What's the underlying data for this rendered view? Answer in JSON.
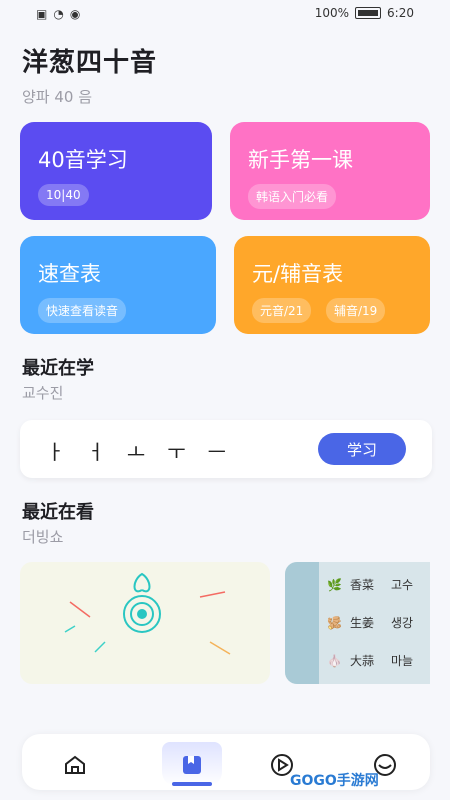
{
  "status": {
    "battery": "100%",
    "time": "6:20"
  },
  "header": {
    "title": "洋葱四十音",
    "subtitle": "양파 40 음"
  },
  "cards": {
    "c1": {
      "title": "40音学习",
      "chip": "10|40"
    },
    "c2": {
      "title": "新手第一课",
      "chip": "韩语入门必看"
    },
    "c3": {
      "title": "速查表",
      "chip": "快速查看读音"
    },
    "c4": {
      "title": "元/辅音表",
      "chip1": "元音/21",
      "chip2": "辅音/19"
    }
  },
  "recent_study": {
    "title": "最近在学",
    "subtitle": "교수진",
    "vowels": [
      "ㅏ",
      "ㅓ",
      "ㅗ",
      "ㅜ",
      "ㅡ"
    ],
    "button": "学习"
  },
  "recent_watch": {
    "title": "最近在看",
    "subtitle": "더빙쇼",
    "video2_rows": [
      {
        "zh": "香菜",
        "kr": "고수",
        "icon": "cilantro-icon"
      },
      {
        "zh": "生姜",
        "kr": "생강",
        "icon": "ginger-icon"
      },
      {
        "zh": "大蒜",
        "kr": "마늘",
        "icon": "garlic-icon"
      }
    ]
  },
  "tabs": [
    {
      "name": "home-icon"
    },
    {
      "name": "study-icon"
    },
    {
      "name": "play-icon"
    },
    {
      "name": "profile-icon"
    }
  ],
  "watermark": "GOGO手游网",
  "colors": {
    "purple": "#5b4cf1",
    "pink": "#ff72c5",
    "blue": "#4aa7ff",
    "orange": "#ffa72a",
    "accent": "#4a66e6"
  }
}
